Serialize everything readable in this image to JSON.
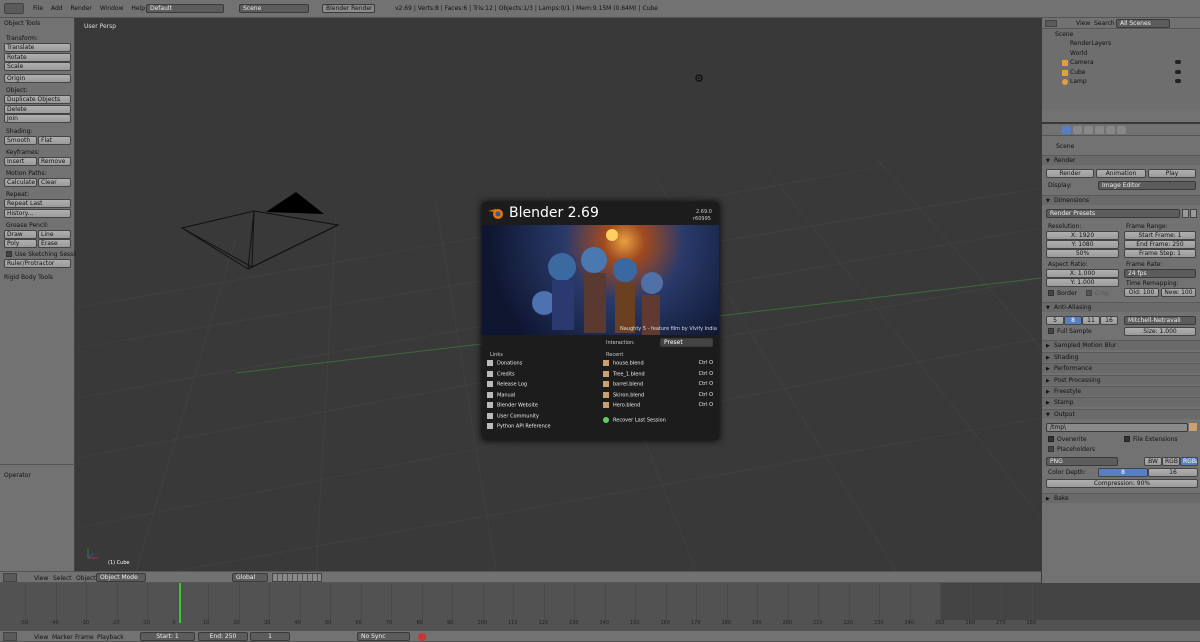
{
  "topbar": {
    "menus": [
      "File",
      "Add",
      "Render",
      "Window",
      "Help"
    ],
    "screen": "Default",
    "scene": "Scene",
    "engine": "Blender Render",
    "stats": "v2.69 | Verts:8 | Faces:6 | Tris:12 | Objects:1/3 | Lamps:0/1 | Mem:9.15M (0.64M) | Cube"
  },
  "toolshelf": {
    "title": "Object Tools",
    "transform_label": "Transform:",
    "translate": "Translate",
    "rotate": "Rotate",
    "scale": "Scale",
    "origin": "Origin",
    "object_label": "Object:",
    "duplicate": "Duplicate Objects",
    "delete": "Delete",
    "join": "Join",
    "shading_label": "Shading:",
    "smooth": "Smooth",
    "flat": "Flat",
    "keyframes_label": "Keyframes:",
    "insert": "Insert",
    "remove": "Remove",
    "motion_label": "Motion Paths:",
    "calculate": "Calculate",
    "clear": "Clear",
    "repeat_label": "Repeat:",
    "repeat_last": "Repeat Last",
    "history": "History...",
    "grease_label": "Grease Pencil:",
    "draw": "Draw",
    "line": "Line",
    "poly": "Poly",
    "erase": "Erase",
    "sketch": "Use Sketching Sessions",
    "ruler": "Ruler/Protractor",
    "rigid": "Rigid Body Tools",
    "operator": "Operator"
  },
  "viewport": {
    "view_label": "User Persp",
    "object_label": "(1) Cube"
  },
  "splash": {
    "title": "Blender 2.69",
    "version": "2.69.0",
    "rev": "r60995",
    "caption": "Naughty 5 - feature film by Vivify India",
    "interaction_label": "Interaction:",
    "interaction_value": "Preset",
    "links_header": "Links",
    "links": [
      "Donations",
      "Credits",
      "Release Log",
      "Manual",
      "Blender Website",
      "User Community",
      "Python API Reference"
    ],
    "recent_header": "Recent",
    "recent": [
      {
        "name": "house.blend",
        "shortcut": "Ctrl O"
      },
      {
        "name": "Tree_1.blend",
        "shortcut": "Ctrl O"
      },
      {
        "name": "barrel.blend",
        "shortcut": "Ctrl O"
      },
      {
        "name": "Skiron.blend",
        "shortcut": "Ctrl O"
      },
      {
        "name": "Hero.blend",
        "shortcut": "Ctrl O"
      }
    ],
    "recover": "Recover Last Session"
  },
  "outliner": {
    "view": "View",
    "search": "Search",
    "filter": "All Scenes",
    "items": [
      "Scene",
      "RenderLayers",
      "World",
      "Camera",
      "Cube",
      "Lamp"
    ]
  },
  "props": {
    "scene": "Scene",
    "render_sec": "Render",
    "render_btn": "Render",
    "animation_btn": "Animation",
    "play_btn": "Play",
    "display_label": "Display:",
    "display_value": "Image Editor",
    "dimensions": "Dimensions",
    "presets": "Render Presets",
    "resolution": "Resolution:",
    "res_x": "X: 1920",
    "res_y": "Y: 1080",
    "res_pct": "50%",
    "frame_range": "Frame Range:",
    "start_frame": "Start Frame: 1",
    "end_frame": "End Frame: 250",
    "frame_step": "Frame Step: 1",
    "aspect": "Aspect Ratio:",
    "asp_x": "X: 1.000",
    "asp_y": "Y: 1.000",
    "frame_rate": "Frame Rate:",
    "fps": "24 fps",
    "remap": "Time Remapping:",
    "old": "Old: 100",
    "new": "New: 100",
    "border": "Border",
    "crop": "Crop",
    "aa": "Anti-Aliasing",
    "aa_opts": [
      "5",
      "8",
      "11",
      "16"
    ],
    "aa_filter": "Mitchell-Netravali",
    "full_sample": "Full Sample",
    "size": "Size: 1.000",
    "smb": "Sampled Motion Blur",
    "shading": "Shading",
    "performance": "Performance",
    "post": "Post Processing",
    "freestyle": "Freestyle",
    "stamp": "Stamp",
    "output": "Output",
    "path": "/tmp\\",
    "overwrite": "Overwrite",
    "file_ext": "File Extensions",
    "placeholders": "Placeholders",
    "format": "PNG",
    "bw": "BW",
    "rgb": "RGB",
    "rgba": "RGBA",
    "color_depth": "Color Depth:",
    "depth8": "8",
    "depth16": "16",
    "compression": "Compression: 90%",
    "bake": "Bake"
  },
  "view3d_header": {
    "view": "View",
    "select": "Select",
    "object": "Object",
    "mode": "Object Mode",
    "orientation": "Global"
  },
  "timeline": {
    "ticks": [
      "-50",
      "-40",
      "-30",
      "-20",
      "-10",
      "0",
      "10",
      "20",
      "30",
      "40",
      "50",
      "60",
      "70",
      "80",
      "90",
      "100",
      "110",
      "120",
      "130",
      "140",
      "150",
      "160",
      "170",
      "180",
      "190",
      "200",
      "210",
      "220",
      "230",
      "240",
      "250",
      "260",
      "270",
      "280"
    ]
  },
  "footer": {
    "view": "View",
    "marker": "Marker",
    "frame": "Frame",
    "playback": "Playback",
    "start": "Start: 1",
    "end": "End: 250",
    "current": "1",
    "sync": "No Sync"
  }
}
